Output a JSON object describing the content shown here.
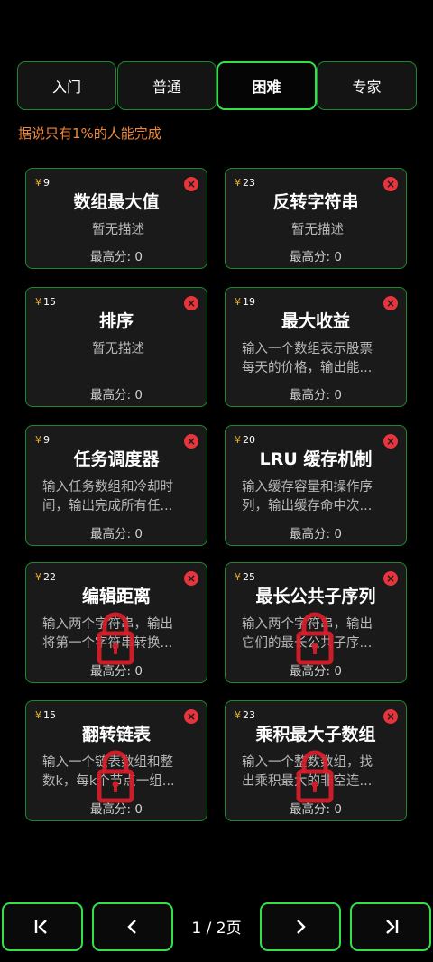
{
  "tabs": [
    {
      "label": "入门"
    },
    {
      "label": "普通"
    },
    {
      "label": "困难"
    },
    {
      "label": "专家"
    }
  ],
  "active_tab": "困难",
  "notice": "据说只有1%的人能完成",
  "currency_symbol": "¥",
  "close_symbol": "×",
  "cards": [
    {
      "price": "9",
      "title": "数组最大值",
      "desc": [
        "暂无描述"
      ],
      "score": "最高分: 0",
      "locked": false
    },
    {
      "price": "23",
      "title": "反转字符串",
      "desc": [
        "暂无描述"
      ],
      "score": "最高分: 0",
      "locked": false
    },
    {
      "price": "15",
      "title": "排序",
      "desc": [
        "暂无描述"
      ],
      "score": "最高分: 0",
      "locked": false
    },
    {
      "price": "19",
      "title": "最大收益",
      "desc": [
        "输入一个数组表示股票",
        "每天的价格，输出能..."
      ],
      "score": "最高分: 0",
      "locked": false
    },
    {
      "price": "9",
      "title": "任务调度器",
      "desc": [
        "输入任务数组和冷却时",
        "间，输出完成所有任..."
      ],
      "score": "最高分: 0",
      "locked": false
    },
    {
      "price": "20",
      "title": "LRU 缓存机制",
      "desc": [
        "输入缓存容量和操作序",
        "列，输出缓存命中次..."
      ],
      "score": "最高分: 0",
      "locked": false
    },
    {
      "price": "22",
      "title": "编辑距离",
      "desc": [
        "输入两个字符串，输出",
        "将第一个字符串转换..."
      ],
      "score": "最高分: 0",
      "locked": true
    },
    {
      "price": "25",
      "title": "最长公共子序列",
      "desc": [
        "输入两个字符串，输出",
        "它们的最长公共子序..."
      ],
      "score": "最高分: 0",
      "locked": true
    },
    {
      "price": "15",
      "title": "翻转链表",
      "desc": [
        "输入一个链表数组和整",
        "数k，每k个节点一组..."
      ],
      "score": "最高分: 0",
      "locked": true
    },
    {
      "price": "23",
      "title": "乘积最大子数组",
      "desc": [
        "输入一个整数数组，找",
        "出乘积最大的非空连..."
      ],
      "score": "最高分: 0",
      "locked": true
    }
  ],
  "pagination": {
    "indicator": "1 / 2页",
    "first_icon": "first-page-icon",
    "prev_icon": "prev-page-icon",
    "next_icon": "next-page-icon",
    "last_icon": "last-page-icon"
  },
  "colors": {
    "accent_green": "#33e04a",
    "border_green": "#1c8a2a",
    "notice_orange": "#f0883a",
    "close_red": "#e8343c",
    "lock_red": "#d81e2a",
    "currency_gold": "#e8b030"
  }
}
